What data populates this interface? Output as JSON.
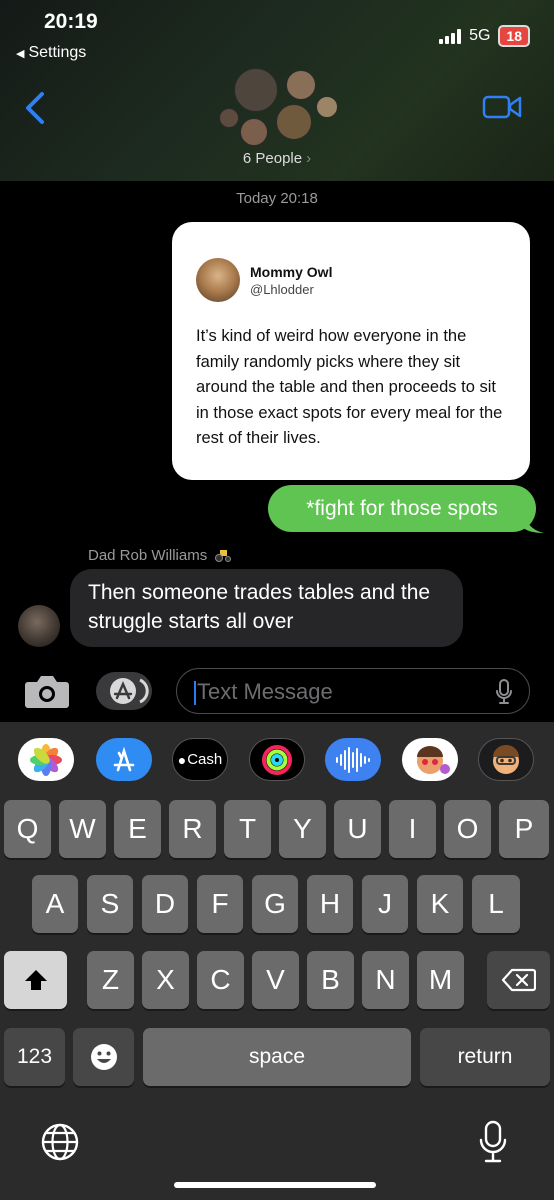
{
  "status_bar": {
    "time": "20:19",
    "back_label": "Settings",
    "network": "5G",
    "battery": "18"
  },
  "header": {
    "group_label": "6 People"
  },
  "conversation": {
    "timestamp": "Today 20:18",
    "tweet": {
      "name": "Mommy Owl",
      "handle": "@Lhlodder",
      "text": "It’s kind of weird how everyone in the family randomly picks where they sit around the table and then proceeds to sit in those exact spots for every meal for the rest of their lives."
    },
    "sent_message": "*fight for those spots",
    "sender_name": "Dad Rob Williams",
    "received_message": "Then someone trades tables and the struggle starts all over"
  },
  "compose": {
    "placeholder": "Text Message"
  },
  "app_drawer": {
    "items": [
      {
        "name": "photos-app",
        "label": ""
      },
      {
        "name": "app-store-app",
        "label": ""
      },
      {
        "name": "apple-cash-app",
        "label": "Cash"
      },
      {
        "name": "activity-app",
        "label": ""
      },
      {
        "name": "audio-message-app",
        "label": ""
      },
      {
        "name": "memoji-stickers-app",
        "label": ""
      },
      {
        "name": "animoji-app",
        "label": ""
      }
    ]
  },
  "keyboard": {
    "row1": [
      "Q",
      "W",
      "E",
      "R",
      "T",
      "Y",
      "U",
      "I",
      "O",
      "P"
    ],
    "row2": [
      "A",
      "S",
      "D",
      "F",
      "G",
      "H",
      "J",
      "K",
      "L"
    ],
    "row3": [
      "Z",
      "X",
      "C",
      "V",
      "B",
      "N",
      "M"
    ],
    "numbers_label": "123",
    "space_label": "space",
    "return_label": "return"
  }
}
